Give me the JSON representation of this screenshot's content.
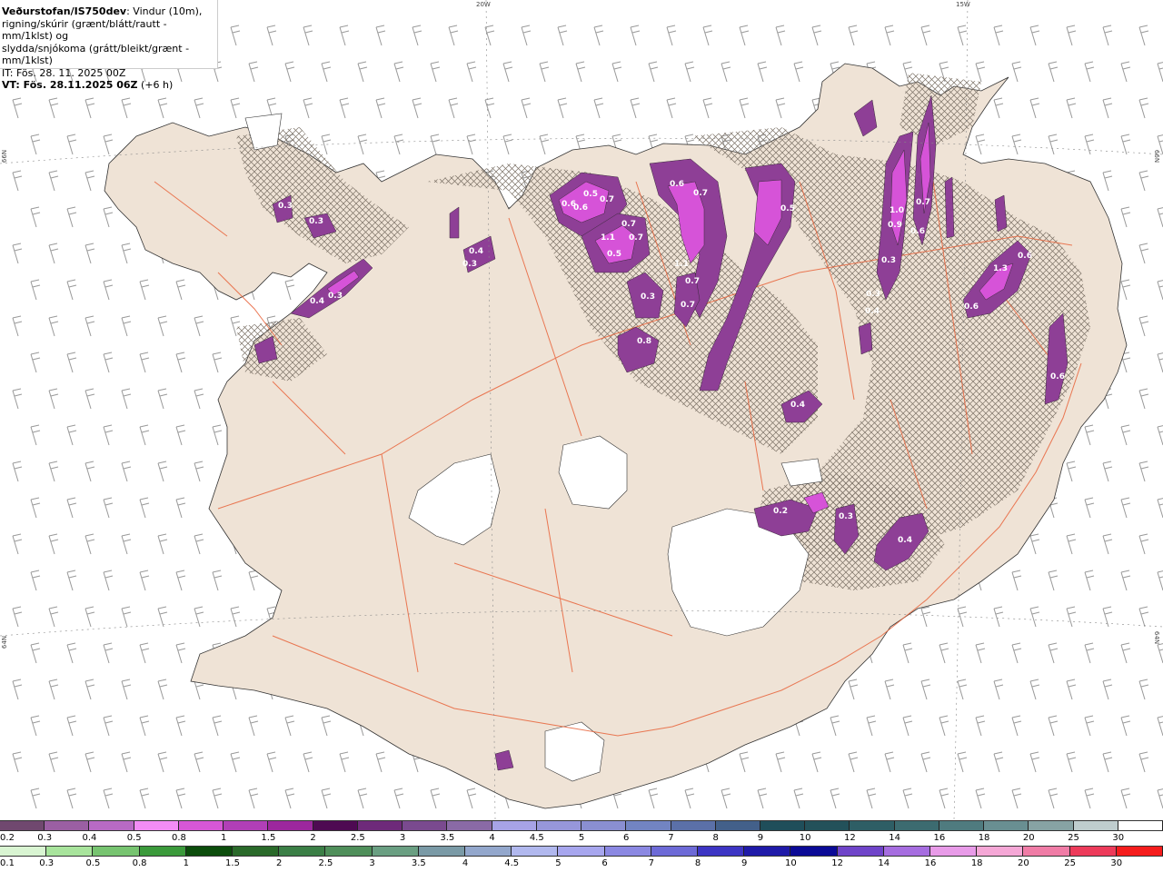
{
  "header": {
    "source": "Veðurstofan/IS750dev",
    "desc_line1": ": Vindur (10m),",
    "desc_line2": "rigning/skúrir (grænt/blátt/rautt - mm/1klst) og",
    "desc_line3": "slydda/snjókoma (grátt/bleikt/grænt - mm/1klst)",
    "it_line": "IT: Fös. 28. 11. 2025 00Z",
    "vt_bold": "VT: Fös. 28.11.2025 06Z",
    "vt_suffix": " (+6 h)"
  },
  "grid_labels": {
    "w20": "20W",
    "w15": "15W",
    "n66_left": "66N",
    "n66_right": "66N",
    "n64_left": "64N",
    "n64_right": "64N"
  },
  "precip_labels": [
    "0.3",
    "0.3",
    "0.4",
    "0.3",
    "0.4",
    "0.3",
    "0.5",
    "0.6",
    "0.7",
    "0.6",
    "1.1",
    "0.7",
    "0.5",
    "0.7",
    "1.1",
    "0.6",
    "0.7",
    "0.7",
    "0.3",
    "0.7",
    "0.5",
    "1.0",
    "0.9",
    "0.6",
    "0.7",
    "0.3",
    "0.3",
    "0.4",
    "1.3",
    "0.6",
    "0.6",
    "0.8",
    "0.4",
    "0.6",
    "0.2",
    "0.3",
    "0.4"
  ],
  "colors": {
    "land": "#efe3d6",
    "roads": "#e8633a",
    "snow_purple": "#8e3f96",
    "snow_magenta": "#d653d8",
    "sea": "#ffffff"
  },
  "scale_snow": {
    "labels": [
      "0.2",
      "0.3",
      "0.4",
      "0.5",
      "0.8",
      "1",
      "1.5",
      "2",
      "2.5",
      "3",
      "3.5",
      "4",
      "4.5",
      "5",
      "6",
      "7",
      "8",
      "9",
      "10",
      "12",
      "14",
      "16",
      "18",
      "20",
      "25",
      "30"
    ],
    "colors": [
      "#70486f",
      "#9b5fa3",
      "#b86ac4",
      "#f28cf5",
      "#d657d6",
      "#b13fb7",
      "#9c279e",
      "#4e0a52",
      "#6e2a7a",
      "#7a4a8f",
      "#8a6aa6",
      "#a7a3e6",
      "#9797da",
      "#8a8fd2",
      "#7284c2",
      "#5b70a8",
      "#43608a",
      "#1f4e5a",
      "#23515a",
      "#2e5e65",
      "#3c6b70",
      "#4f7b7f",
      "#698f92",
      "#87a3a4",
      "#bfcdce",
      "#ffffff"
    ]
  },
  "scale_rain": {
    "labels": [
      "0.1",
      "0.3",
      "0.5",
      "0.8",
      "1",
      "1.5",
      "2",
      "2.5",
      "3",
      "3.5",
      "4",
      "4.5",
      "5",
      "6",
      "7",
      "8",
      "9",
      "10",
      "12",
      "14",
      "16",
      "18",
      "20",
      "25",
      "30"
    ],
    "colors": [
      "#d9f5d2",
      "#a8e49c",
      "#77c470",
      "#3b9a3b",
      "#0c4d0c",
      "#2a6a2a",
      "#3b7f46",
      "#4f8f5a",
      "#6a9f82",
      "#7a9aa6",
      "#93a7cc",
      "#b1b8ee",
      "#a7a6ee",
      "#8b88e2",
      "#6d6ad7",
      "#3d35c4",
      "#1f1aa8",
      "#0b0a96",
      "#6f44c9",
      "#a66de0",
      "#e89be8",
      "#f5a7d6",
      "#f07ca6",
      "#ed3b5a",
      "#f51d1d"
    ]
  }
}
